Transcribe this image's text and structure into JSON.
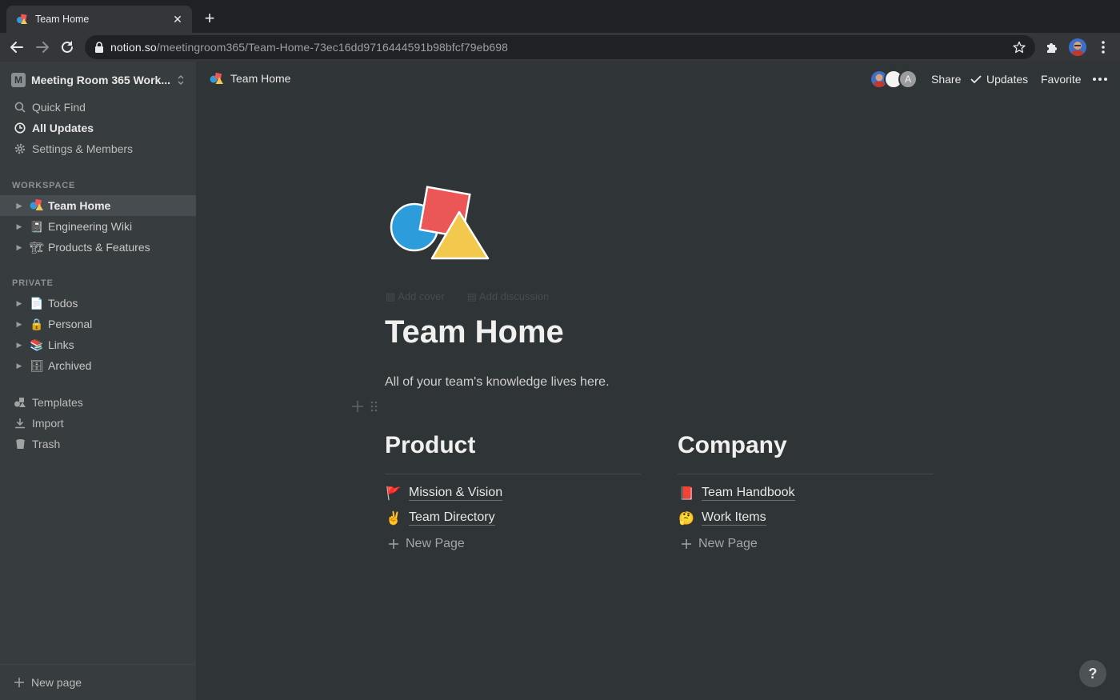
{
  "browser": {
    "tab_title": "Team Home",
    "url_host": "notion.so",
    "url_path": "/meetingroom365/Team-Home-73ec16dd9716444591b98bfcf79eb698"
  },
  "sidebar": {
    "workspace_badge": "M",
    "workspace_name": "Meeting Room 365 Work...",
    "top_items": [
      {
        "label": "Quick Find",
        "icon": "search-icon"
      },
      {
        "label": "All Updates",
        "icon": "clock-icon"
      },
      {
        "label": "Settings & Members",
        "icon": "gear-icon"
      }
    ],
    "workspace_label": "WORKSPACE",
    "workspace_pages": [
      {
        "label": "Team Home",
        "emoji": "🔷"
      },
      {
        "label": "Engineering Wiki",
        "emoji": "📓"
      },
      {
        "label": "Products & Features",
        "emoji": "🏗"
      }
    ],
    "private_label": "PRIVATE",
    "private_pages": [
      {
        "label": "Todos",
        "emoji": "📄"
      },
      {
        "label": "Personal",
        "emoji": "🔒"
      },
      {
        "label": "Links",
        "emoji": "📚"
      },
      {
        "label": "Archived",
        "emoji": "🗄"
      }
    ],
    "bottom_items": [
      {
        "label": "Templates",
        "icon": "templates-icon"
      },
      {
        "label": "Import",
        "icon": "import-icon"
      },
      {
        "label": "Trash",
        "icon": "trash-icon"
      }
    ],
    "new_page_label": "New page"
  },
  "topbar": {
    "breadcrumb": "Team Home",
    "avatar_letter": "A",
    "share_label": "Share",
    "updates_label": "Updates",
    "favorite_label": "Favorite"
  },
  "page": {
    "add_cover_label": "Add cover",
    "add_discussion_label": "Add discussion",
    "title": "Team Home",
    "description": "All of your team's knowledge lives here.",
    "columns": [
      {
        "heading": "Product",
        "links": [
          {
            "label": "Mission & Vision",
            "emoji": "🚩"
          },
          {
            "label": "Team Directory",
            "emoji": "✌️"
          }
        ],
        "new_page_label": "New Page"
      },
      {
        "heading": "Company",
        "links": [
          {
            "label": "Team Handbook",
            "emoji": "📕"
          },
          {
            "label": "Work Items",
            "emoji": "🤔"
          }
        ],
        "new_page_label": "New Page"
      }
    ],
    "help_label": "?"
  },
  "colors": {
    "background": "#2f3437",
    "sidebar": "#373c3f",
    "shape_blue": "#2d9cdb",
    "shape_red": "#eb5757",
    "shape_yellow": "#f2c94c"
  }
}
